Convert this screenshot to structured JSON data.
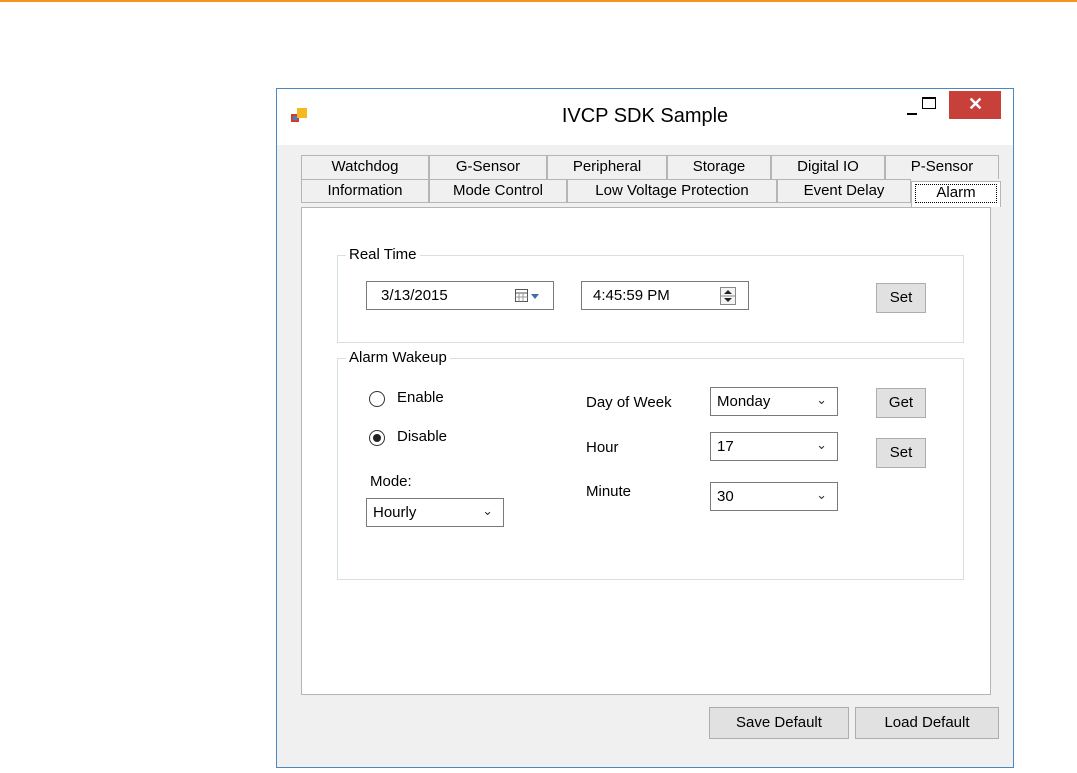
{
  "window": {
    "title": "IVCP SDK Sample",
    "close_glyph": "✕"
  },
  "tabs": {
    "row_top": [
      "Watchdog",
      "G-Sensor",
      "Peripheral",
      "Storage",
      "Digital IO",
      "P-Sensor"
    ],
    "row_bottom": [
      "Information",
      "Mode Control",
      "Low Voltage Protection",
      "Event Delay",
      "Alarm"
    ],
    "active": "Alarm"
  },
  "real_time": {
    "label": "Real Time",
    "date": "3/13/2015",
    "time": "4:45:59 PM",
    "set_label": "Set"
  },
  "alarm_wakeup": {
    "label": "Alarm Wakeup",
    "enable_label": "Enable",
    "disable_label": "Disable",
    "selected": "Disable",
    "mode_label": "Mode:",
    "mode_value": "Hourly",
    "day_of_week_label": "Day of Week",
    "day_of_week_value": "Monday",
    "hour_label": "Hour",
    "hour_value": "17",
    "minute_label": "Minute",
    "minute_value": "30",
    "get_label": "Get",
    "set_label": "Set"
  },
  "footer": {
    "save_default_label": "Save Default",
    "load_default_label": "Load Default"
  },
  "colors": {
    "accent_rule": "#f0961e",
    "close_button": "#c7413a",
    "window_border": "#4a88c2"
  },
  "icons": {
    "app": "app-icon",
    "calendar": "calendar-icon",
    "dropdown": "chevron-down-icon",
    "spinner": "spinner-icon"
  }
}
